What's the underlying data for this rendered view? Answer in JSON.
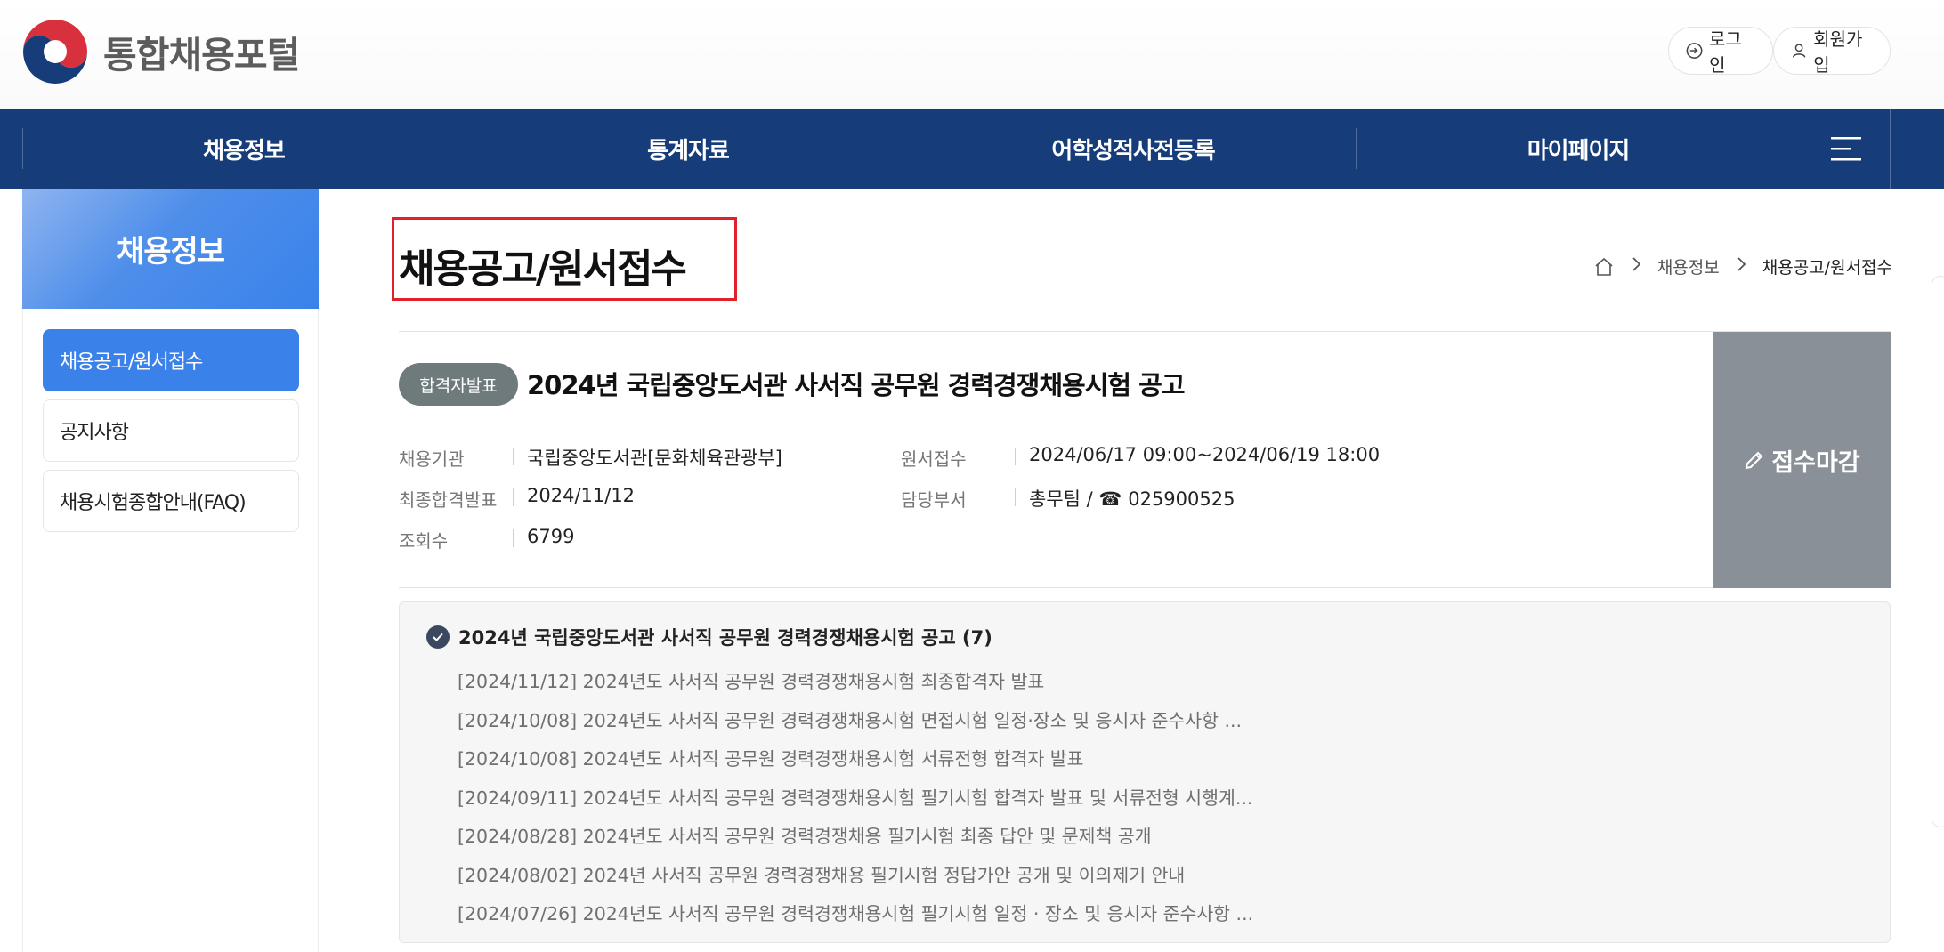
{
  "header": {
    "site_title": "통합채용포털",
    "login_label": "로그인",
    "signup_label": "회원가입"
  },
  "nav": {
    "items": [
      "채용정보",
      "통계자료",
      "어학성적사전등록",
      "마이페이지"
    ],
    "menu_icon": "hamburger-icon"
  },
  "sidebar": {
    "title": "채용정보",
    "items": [
      {
        "label": "채용공고/원서접수",
        "active": true
      },
      {
        "label": "공지사항",
        "active": false
      },
      {
        "label": "채용시험종합안내(FAQ)",
        "active": false
      }
    ]
  },
  "main": {
    "page_title": "채용공고/원서접수",
    "breadcrumb": [
      "채용정보",
      "채용공고/원서접수"
    ],
    "post": {
      "badge": "합격자발표",
      "title": "2024년 국립중앙도서관 사서직 공무원 경력경쟁채용시험 공고",
      "info": {
        "agency_label": "채용기관",
        "agency_value": "국립중앙도서관[문화체육관광부]",
        "final_label": "최종합격발표",
        "final_value": "2024/11/12",
        "views_label": "조회수",
        "views_value": "6799",
        "apply_label": "원서접수",
        "apply_value": "2024/06/17 09:00~2024/06/19 18:00",
        "dept_label": "담당부서",
        "dept_value": "총무팀 / ☎ 025900525"
      },
      "status_button": "접수마감"
    },
    "notices": {
      "heading": "2024년 국립중앙도서관 사서직 공무원 경력경쟁채용시험 공고 (7)",
      "items": [
        "[2024/11/12] 2024년도 사서직 공무원 경력경쟁채용시험 최종합격자 발표",
        "[2024/10/08] 2024년도 사서직 공무원 경력경쟁채용시험 면접시험 일정·장소 및 응시자 준수사항 ...",
        "[2024/10/08] 2024년도 사서직 공무원 경력경쟁채용시험 서류전형 합격자 발표",
        "[2024/09/11] 2024년도 사서직 공무원 경력경쟁채용시험 필기시험 합격자 발표 및 서류전형 시행계...",
        "[2024/08/28] 2024년도 사서직 공무원 경력경쟁채용 필기시험 최종 답안 및 문제책 공개",
        "[2024/08/02] 2024년 사서직 공무원 경력경쟁채용 필기시험 정답가안 공개 및 이의제기 안내",
        "[2024/07/26] 2024년도 사서직 공무원 경력경쟁채용시험 필기시험 일정 · 장소 및 응시자 준수사항 ..."
      ]
    }
  },
  "colors": {
    "nav_bg": "#173c7a",
    "accent": "#3a82ea",
    "badge": "#6f7a7d",
    "closed": "#8a9097",
    "highlight": "#e0202a"
  }
}
